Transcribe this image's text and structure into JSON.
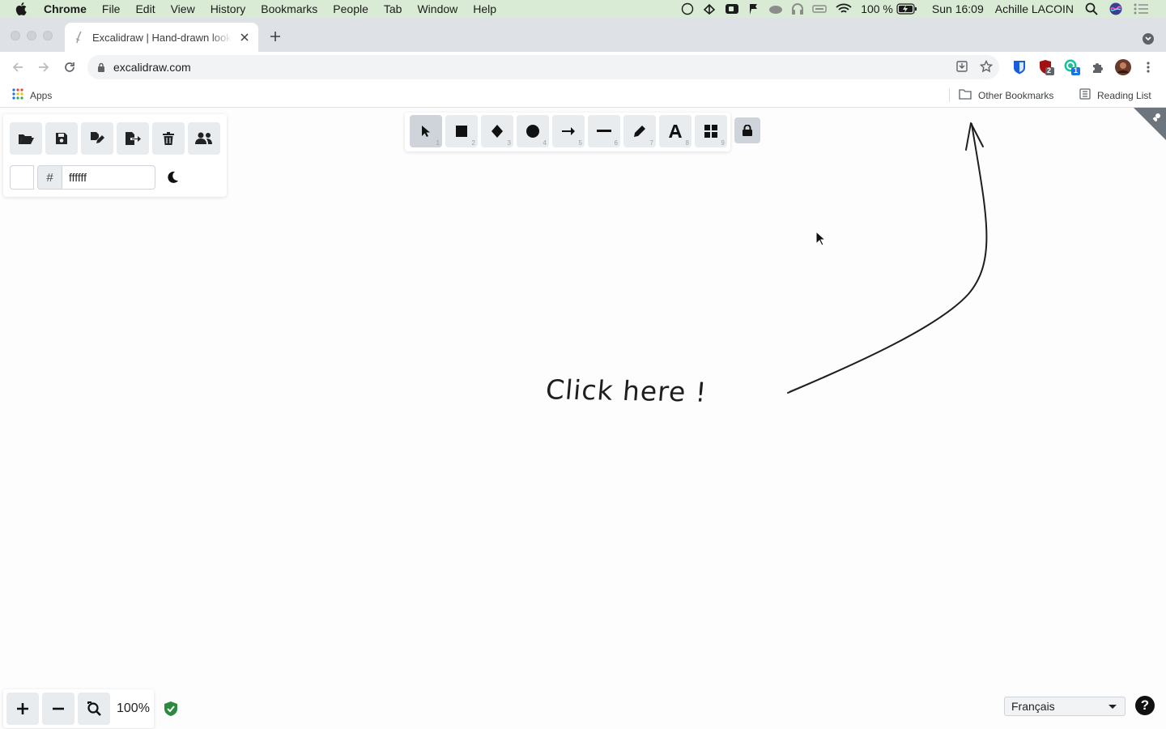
{
  "menubar": {
    "app": "Chrome",
    "menus": [
      "File",
      "Edit",
      "View",
      "History",
      "Bookmarks",
      "People",
      "Tab",
      "Window",
      "Help"
    ],
    "battery": "100 %",
    "clock": "Sun 16:09",
    "user": "Achille LACOIN"
  },
  "browser": {
    "tab_title": "Excalidraw | Hand-drawn look & feel",
    "url": "excalidraw.com",
    "bookmarks": {
      "apps": "Apps",
      "other": "Other Bookmarks",
      "reading": "Reading List"
    },
    "extension_badges": {
      "ublock": "2",
      "grammarly": "1"
    }
  },
  "app_menu": {
    "buttons": [
      {
        "name": "open-icon"
      },
      {
        "name": "save-icon"
      },
      {
        "name": "save-as-icon"
      },
      {
        "name": "export-icon"
      },
      {
        "name": "clear-canvas-icon"
      },
      {
        "name": "collaborate-icon"
      }
    ],
    "background_color_prefix": "#",
    "background_color_value": "ffffff",
    "theme_icon": "moon-icon"
  },
  "toolbar": {
    "tools": [
      {
        "name": "selection",
        "key": "1"
      },
      {
        "name": "rectangle",
        "key": "2"
      },
      {
        "name": "diamond",
        "key": "3"
      },
      {
        "name": "ellipse",
        "key": "4"
      },
      {
        "name": "arrow",
        "key": "5"
      },
      {
        "name": "line",
        "key": "6"
      },
      {
        "name": "draw",
        "key": "7"
      },
      {
        "name": "text",
        "key": "8"
      },
      {
        "name": "library",
        "key": "9"
      }
    ],
    "active_tool": "selection"
  },
  "canvas": {
    "annotation_text": "Click here !"
  },
  "footer": {
    "zoom": "100%",
    "language": "Français",
    "help": "?"
  },
  "colors": {
    "menubar_bg": "#d9ead5",
    "tool_bg": "#e9ecef",
    "tool_active_bg": "#ced4da",
    "shield_green": "#2b8a3e"
  }
}
